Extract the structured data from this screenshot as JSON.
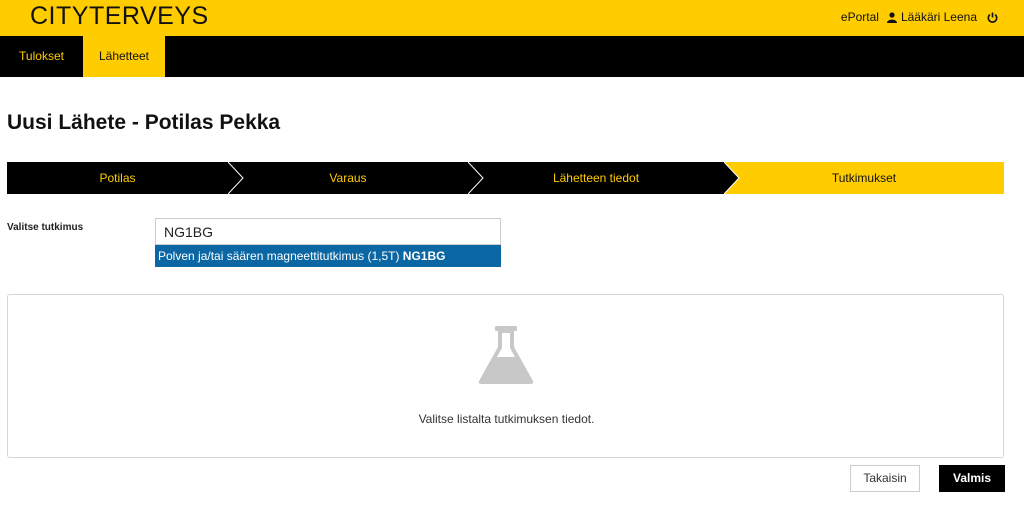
{
  "header": {
    "logo": "CITYTERVEYS",
    "eportal_link": "ePortal",
    "user_name": "Lääkäri Leena"
  },
  "nav": {
    "tabs": [
      {
        "label": "Tulokset"
      },
      {
        "label": "Lähetteet"
      }
    ],
    "active": "Lähetteet"
  },
  "page": {
    "title": "Uusi Lähete - Potilas Pekka"
  },
  "stepper": {
    "steps": [
      {
        "label": "Potilas"
      },
      {
        "label": "Varaus"
      },
      {
        "label": "Lähetteen tiedot"
      },
      {
        "label": "Tutkimukset"
      }
    ],
    "active": "Tutkimukset"
  },
  "form": {
    "field_label": "Valitse tutkimus",
    "search_value": "NG1BG",
    "suggestion": {
      "text": "Polven ja/tai säären magneettitutkimus (1,5T)",
      "code": "NG1BG"
    }
  },
  "empty_state": {
    "icon": "flask-icon",
    "message": "Valitse listalta tutkimuksen tiedot."
  },
  "actions": {
    "back_label": "Takaisin",
    "done_label": "Valmis"
  },
  "colors": {
    "brand_yellow": "#ffcc00",
    "nav_black": "#000000",
    "selection_blue": "#0a67a3"
  }
}
